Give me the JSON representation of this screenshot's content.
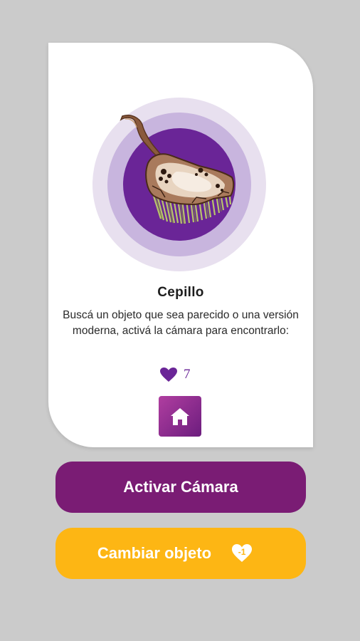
{
  "card": {
    "object_name": "Cepillo",
    "description": "Buscá un objeto que sea parecido o una versión moderna, activá la cámara para encontrarlo:",
    "lives_count": "7",
    "icons": {
      "object_image": "brush-illustration",
      "lives": "heart-icon",
      "home": "home-icon"
    }
  },
  "actions": {
    "activate_camera_label": "Activar Cámara",
    "change_object_label": "Cambiar objeto",
    "change_object_cost": "-1",
    "change_object_cost_icon": "heart-icon"
  },
  "colors": {
    "background": "#cbcbcb",
    "card": "#ffffff",
    "primary_purple": "#7a1c74",
    "ring_inner": "#6a2597",
    "ring_mid": "#c8b5de",
    "ring_outer": "#e8e0ef",
    "accent_yellow": "#fdb614"
  }
}
